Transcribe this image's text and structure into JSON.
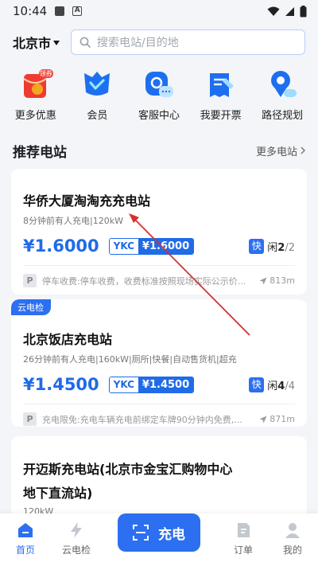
{
  "status_bar": {
    "time": "10:44"
  },
  "header": {
    "city": "北京市",
    "search_placeholder": "搜索电站/目的地"
  },
  "quick_entries": [
    {
      "label": "更多优惠",
      "icon": "gift-envelope-icon",
      "badge": "领券"
    },
    {
      "label": "会员",
      "icon": "member-crown-icon"
    },
    {
      "label": "客服中心",
      "icon": "customer-service-icon"
    },
    {
      "label": "我要开票",
      "icon": "invoice-icon"
    },
    {
      "label": "路径规划",
      "icon": "route-plan-icon"
    }
  ],
  "section": {
    "title": "推荐电站",
    "more": "更多电站"
  },
  "stations": [
    {
      "name": "华侨大厦淘淘充充电站",
      "meta": "8分钟前有人充电|120kW",
      "price": "¥1.6000",
      "ykc_label": "YKC",
      "ykc_price": "¥1.6000",
      "fast_label": "快",
      "idle_label": "闲",
      "idle": "2",
      "total": "/2",
      "parking": "停车收费:停车收费，收费标准按照现场实际公示价...",
      "distance": "813m"
    },
    {
      "tag": "云电检",
      "name": "北京饭店充电站",
      "meta": "26分钟前有人充电|160kW|厕所|快餐|自动售货机|超充",
      "price": "¥1.4500",
      "ykc_label": "YKC",
      "ykc_price": "¥1.4500",
      "fast_label": "快",
      "idle_label": "闲",
      "idle": "4",
      "total": "/4",
      "parking": "充电限免:充电车辆充电前绑定车牌90分钟内免费,...",
      "distance": "871m"
    },
    {
      "name_line1": "开迈斯充电站(北京市金宝汇购物中心",
      "name_line2": "地下直流站)",
      "meta": "120kW"
    }
  ],
  "bottom_nav": {
    "home": "首页",
    "cloud_check": "云电检",
    "charge": "充电",
    "orders": "订单",
    "mine": "我的"
  },
  "colors": {
    "accent": "#2c6ff0",
    "annotation_arrow": "#d9302b"
  }
}
